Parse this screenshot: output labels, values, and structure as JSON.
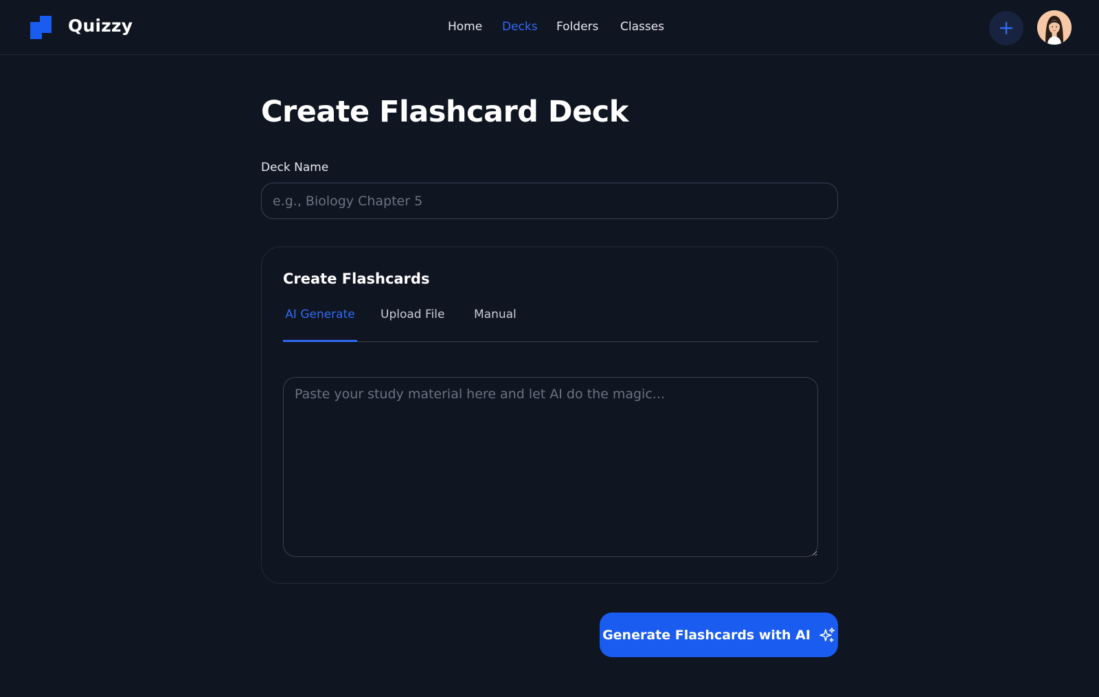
{
  "app": {
    "name": "Quizzy"
  },
  "nav": {
    "items": [
      {
        "label": "Home",
        "active": false
      },
      {
        "label": "Decks",
        "active": true
      },
      {
        "label": "Folders",
        "active": false
      },
      {
        "label": "Classes",
        "active": false
      }
    ]
  },
  "header": {
    "add_icon": "plus-icon",
    "avatar_icon": "user-avatar"
  },
  "main": {
    "title": "Create Flashcard Deck",
    "deck_name": {
      "label": "Deck Name",
      "value": "",
      "placeholder": "e.g., Biology Chapter 5"
    },
    "flashcards_card": {
      "title": "Create Flashcards",
      "tabs": [
        {
          "label": "AI Generate",
          "active": true
        },
        {
          "label": "Upload File",
          "active": false
        },
        {
          "label": "Manual",
          "active": false
        }
      ],
      "material": {
        "value": "",
        "placeholder": "Paste your study material here and let AI do the magic..."
      }
    },
    "generate_button": {
      "label": "Generate Flashcards with AI",
      "icon": "sparkles-icon"
    }
  },
  "colors": {
    "background": "#101522",
    "accent": "#1a5cf0",
    "active_link": "#2f6bf5",
    "border": "#3a4254",
    "placeholder": "#6b7280"
  }
}
